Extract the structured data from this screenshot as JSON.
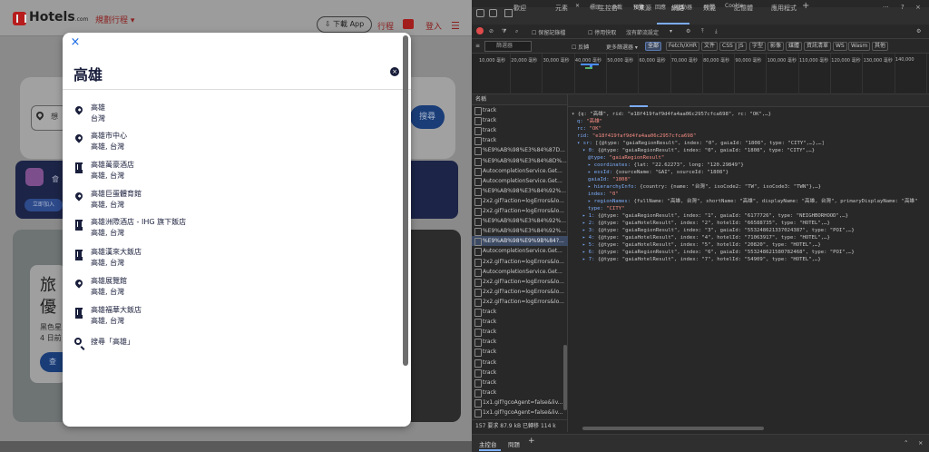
{
  "site": {
    "logo": "Hotels",
    "logo_suffix": ".com",
    "trips_dropdown": "規劃行程 ▾",
    "get_app": "⇩ 下載 App",
    "nav_trips": "行程",
    "nav_login": "登入",
    "search_placeholder": "想",
    "search_button": "搜尋",
    "promo_text": "會",
    "promo_button": "立即加入",
    "hero_title_1": "旅",
    "hero_title_2": "優",
    "hero_line_1": "黑色星",
    "hero_line_2": "4 日前",
    "hero_button": "查"
  },
  "modal": {
    "close_icon": "×",
    "query": "高雄",
    "clear_icon": "×",
    "suggestions": [
      {
        "icon": "pin",
        "title": "高雄",
        "subtitle": "台灣"
      },
      {
        "icon": "pin",
        "title": "高雄市中心",
        "subtitle": "高雄, 台灣"
      },
      {
        "icon": "building",
        "title": "高雄萬豪酒店",
        "subtitle": "高雄, 台灣"
      },
      {
        "icon": "pin",
        "title": "高雄巨蛋體育館",
        "subtitle": "高雄, 台灣"
      },
      {
        "icon": "building",
        "title": "高雄洲際酒店 - IHG 旗下飯店",
        "subtitle": "高雄, 台灣"
      },
      {
        "icon": "building",
        "title": "高雄漢來大飯店",
        "subtitle": "高雄, 台灣"
      },
      {
        "icon": "pin",
        "title": "高雄展覽館",
        "subtitle": "高雄, 台灣"
      },
      {
        "icon": "building",
        "title": "高雄福華大飯店",
        "subtitle": "高雄, 台灣"
      }
    ],
    "search_all": "搜尋「高雄」"
  },
  "devtools": {
    "tabs": [
      "歡迎",
      "元素",
      "主控台",
      "來源",
      "網路",
      "效能",
      "記憶體",
      "應用程式"
    ],
    "active_tab": "網路",
    "toolbar2": {
      "preserve_log": "保留記錄檔",
      "disable_cache": "停用快取",
      "throttle": "沒有節流設定"
    },
    "filter_placeholder": "篩選器",
    "filter_chips": {
      "invert": "反轉",
      "more_filters": "更多篩選器 ▾",
      "types": [
        "全部",
        "Fetch/XHR",
        "文件",
        "CSS",
        "JS",
        "字型",
        "影像",
        "媒體",
        "資訊清單",
        "WS",
        "Wasm",
        "其他"
      ],
      "selected_type": "全部"
    },
    "timeline_labels": [
      "10,000 毫秒",
      "20,000 毫秒",
      "30,000 毫秒",
      "40,000 毫秒",
      "50,000 毫秒",
      "60,000 毫秒",
      "70,000 毫秒",
      "80,000 毫秒",
      "90,000 毫秒",
      "100,000 毫秒",
      "110,000 毫秒",
      "120,000 毫秒",
      "130,000 毫秒",
      "140,000"
    ],
    "requests_header": "名稱",
    "requests": [
      "track",
      "track",
      "track",
      "track",
      "%E9%AB%98%E3%84%87D...",
      "%E9%AB%98%E3%84%8D%...",
      "AutocompletionService.Get...",
      "AutocompletionService.Get...",
      "%E9%AB%98%E3%84%92%...",
      "2x2.gif?action=logErrors&lo...",
      "2x2.gif?action=logErrors&lo...",
      "%E9%AB%98%E3%84%92%...",
      "%E9%AB%98%E3%84%92%...",
      "%E9%AB%98%E9%9B%84?...",
      "AutocompletionService.Get...",
      "2x2.gif?action=logErrors&lo...",
      "AutocompletionService.Get...",
      "2x2.gif?action=logErrors&lo...",
      "2x2.gif?action=logErrors&lo...",
      "2x2.gif?action=logErrors&lo...",
      "track",
      "track",
      "track",
      "track",
      "track",
      "track",
      "track",
      "track",
      "track",
      "1x1.gif?gcoAgent=false&liv...",
      "1x1.gif?gcoAgent=false&liv..."
    ],
    "selected_request_index": 13,
    "footer": "157 要求   87.9 kB 已轉移   114 k",
    "detail_tabs": [
      "標頭",
      "承載",
      "預覽",
      "回應",
      "啟動器",
      "時間",
      "Cookie"
    ],
    "active_detail_tab": "預覽",
    "preview_lines": [
      {
        "indent": 0,
        "text": "▾ {q: \"高雄\", rid: \"e18f419faf9d4fa4aa06c2957cfca698\", rc: \"OK\",…}"
      },
      {
        "indent": 1,
        "key": "q:",
        "value": "\"高雄\""
      },
      {
        "indent": 1,
        "key": "rc:",
        "value": "\"OK\""
      },
      {
        "indent": 1,
        "key": "rid:",
        "value": "\"e18f419faf9d4fa4aa06c2957cfca698\""
      },
      {
        "indent": 1,
        "key": "▾ sr:",
        "value": "[{@type: \"gaiaRegionResult\", index: \"0\", gaiaId: \"1808\", type: \"CITY\",…},…]"
      },
      {
        "indent": 2,
        "key": "▾ 0:",
        "value": "{@type: \"gaiaRegionResult\", index: \"0\", gaiaId: \"1808\", type: \"CITY\",…}"
      },
      {
        "indent": 3,
        "key": "@type:",
        "value": "\"gaiaRegionResult\""
      },
      {
        "indent": 3,
        "key": "▸ coordinates:",
        "value": "{lat: \"22.62273\", long: \"120.29849\"}"
      },
      {
        "indent": 3,
        "key": "▸ essId:",
        "value": "{sourceName: \"GAI\", sourceId: \"1808\"}"
      },
      {
        "indent": 3,
        "key": "gaiaId:",
        "value": "\"1808\""
      },
      {
        "indent": 3,
        "key": "▸ hierarchyInfo:",
        "value": "{country: {name: \"台灣\", isoCode2: \"TW\", isoCode3: \"TWN\"},…}"
      },
      {
        "indent": 3,
        "key": "index:",
        "value": "\"0\""
      },
      {
        "indent": 3,
        "key": "▸ regionNames:",
        "value": "{fullName: \"高雄, 台灣\", shortName: \"高雄\", displayName: \"高雄, 台灣\", primaryDisplayName: \"高雄\""
      },
      {
        "indent": 3,
        "key": "type:",
        "value": "\"CITY\""
      },
      {
        "indent": 2,
        "key": "▸ 1:",
        "value": "{@type: \"gaiaRegionResult\", index: \"1\", gaiaId: \"6177726\", type: \"NEIGHBORHOOD\",…}"
      },
      {
        "indent": 2,
        "key": "▸ 2:",
        "value": "{@type: \"gaiaHotelResult\", index: \"2\", hotelId: \"66588735\", type: \"HOTEL\",…}"
      },
      {
        "indent": 2,
        "key": "▸ 3:",
        "value": "{@type: \"gaiaRegionResult\", index: \"3\", gaiaId: \"553248621337024387\", type: \"POI\",…}"
      },
      {
        "indent": 2,
        "key": "▸ 4:",
        "value": "{@type: \"gaiaHotelResult\", index: \"4\", hotelId: \"71063917\", type: \"HOTEL\",…}"
      },
      {
        "indent": 2,
        "key": "▸ 5:",
        "value": "{@type: \"gaiaHotelResult\", index: \"5\", hotelId: \"20820\", type: \"HOTEL\",…}"
      },
      {
        "indent": 2,
        "key": "▸ 6:",
        "value": "{@type: \"gaiaRegionResult\", index: \"6\", gaiaId: \"553248621580782468\", type: \"POI\",…}"
      },
      {
        "indent": 2,
        "key": "▸ 7:",
        "value": "{@type: \"gaiaHotelResult\", index: \"7\", hotelId: \"54909\", type: \"HOTEL\",…}"
      }
    ],
    "bottom_tabs": [
      "主控台",
      "問題"
    ],
    "accent": "#7cacf8"
  }
}
